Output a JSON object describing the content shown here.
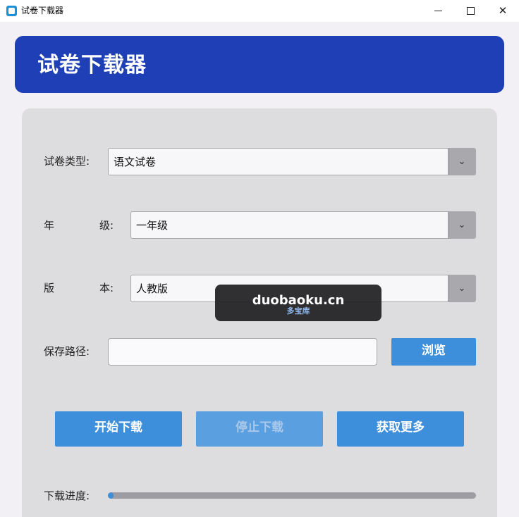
{
  "window": {
    "title": "试卷下载器",
    "minimize_icon": "minimize-icon",
    "maximize_icon": "maximize-icon",
    "close_symbol": "✕"
  },
  "header": {
    "title": "试卷下载器",
    "background": "#1e3fb5"
  },
  "form": {
    "paper_type": {
      "label": "试卷类型:",
      "value": "语文试卷",
      "arrow": "⌄"
    },
    "grade": {
      "label_left": "年",
      "label_right": "级:",
      "value": "一年级",
      "arrow": "⌄"
    },
    "edition": {
      "label_left": "版",
      "label_right": "本:",
      "value": "人教版",
      "arrow": "⌄"
    },
    "save_path": {
      "label": "保存路径:",
      "value": "",
      "browse_label": "浏览"
    }
  },
  "actions": {
    "start_label": "开始下载",
    "stop_label": "停止下载",
    "more_label": "获取更多"
  },
  "progress": {
    "label": "下载进度:",
    "value_fraction": 0.015
  },
  "watermark": {
    "main": "duobaoku.cn",
    "sub": "多宝库"
  },
  "colors": {
    "accent": "#3e8fdb",
    "panel": "#dddcdf"
  }
}
